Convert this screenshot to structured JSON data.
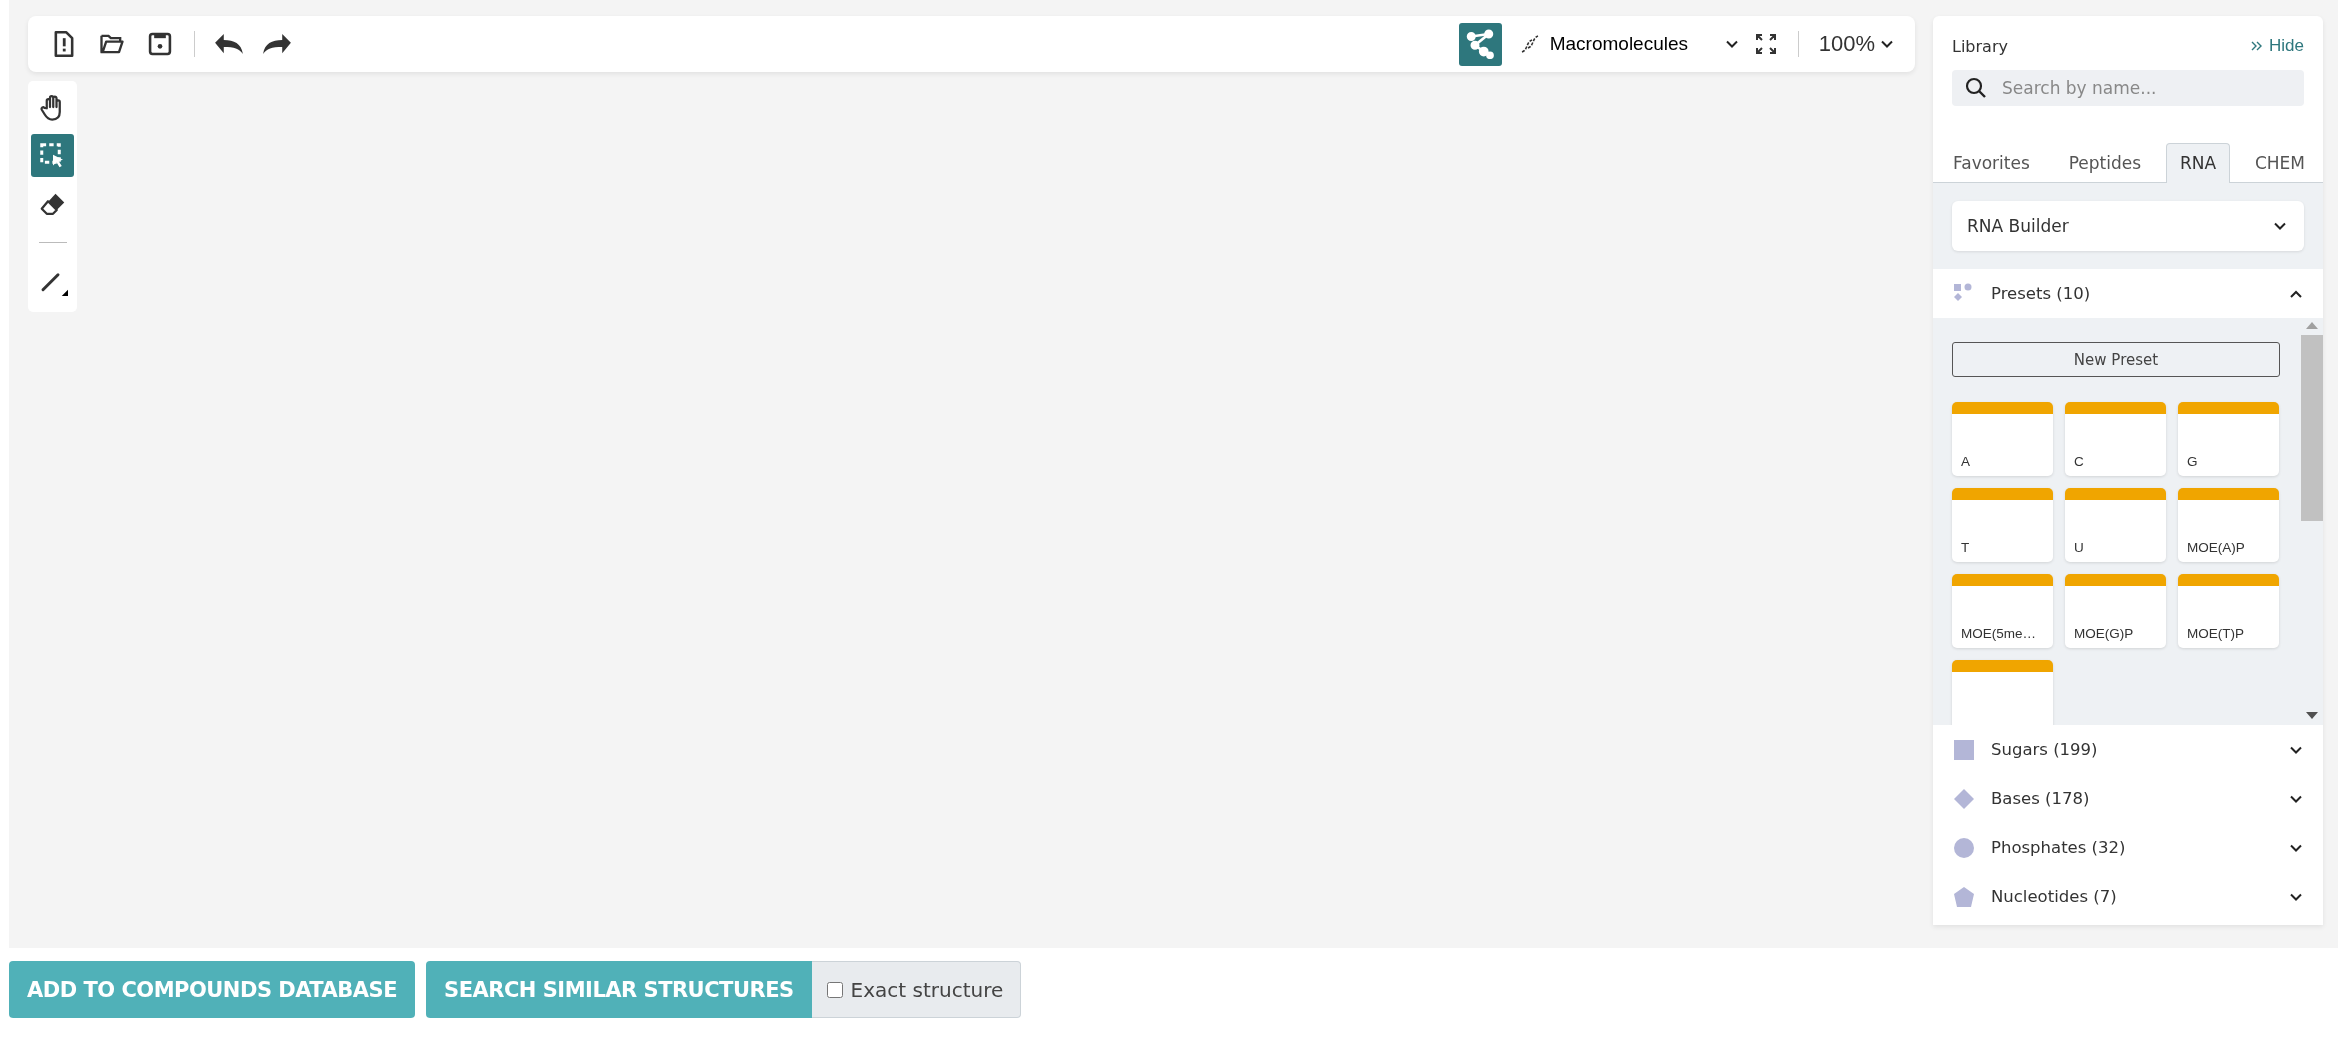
{
  "toolbar": {
    "file_buttons": [
      {
        "kind": "new"
      },
      {
        "kind": "open"
      },
      {
        "kind": "save"
      }
    ],
    "history_buttons": [
      {
        "kind": "undo"
      },
      {
        "kind": "redo"
      }
    ],
    "layout_toggle": {
      "selected": true
    },
    "mode": {
      "label": "Macromolecules"
    },
    "zoom": {
      "value": "100%"
    }
  },
  "tools": [
    {
      "kind": "hand",
      "selected": false
    },
    {
      "kind": "select",
      "selected": true
    },
    {
      "kind": "eraser",
      "selected": false
    },
    {
      "kind": "bond",
      "selected": false
    }
  ],
  "library": {
    "title": "Library",
    "hide": "Hide",
    "search": {
      "placeholder": "Search by name..."
    },
    "tabs": [
      {
        "label": "Favorites",
        "selected": false
      },
      {
        "label": "Peptides",
        "selected": false
      },
      {
        "label": "RNA",
        "selected": true
      },
      {
        "label": "CHEM",
        "selected": false
      }
    ],
    "builder": {
      "label": "RNA Builder"
    },
    "presets": {
      "title": "Presets (10)",
      "expanded": true,
      "new_preset": "New Preset",
      "cards": [
        {
          "label": "A"
        },
        {
          "label": "C"
        },
        {
          "label": "G"
        },
        {
          "label": "T"
        },
        {
          "label": "U"
        },
        {
          "label": "MOE(A)P"
        },
        {
          "label": "MOE(5me…"
        },
        {
          "label": "MOE(G)P"
        },
        {
          "label": "MOE(T)P"
        }
      ],
      "cut_off_card": true
    },
    "sections": [
      {
        "label": "Sugars (199)",
        "kind": "square",
        "expanded": false
      },
      {
        "label": "Bases (178)",
        "kind": "diamond",
        "expanded": false
      },
      {
        "label": "Phosphates (32)",
        "kind": "circle",
        "expanded": false
      },
      {
        "label": "Nucleotides (7)",
        "kind": "pentagon",
        "expanded": false
      }
    ]
  },
  "actions": {
    "buttons": [
      {
        "label": "ADD TO COMPOUNDS DATABASE"
      },
      {
        "label": "SEARCH SIMILAR STRUCTURES"
      }
    ],
    "exact": {
      "label": "Exact structure",
      "checked": false
    }
  }
}
